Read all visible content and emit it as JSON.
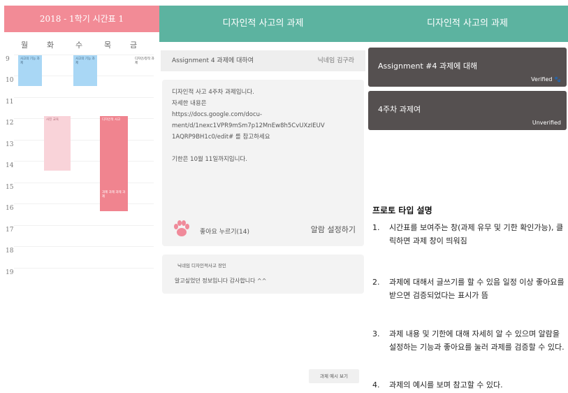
{
  "timetable": {
    "title": "2018 - 1학기 시간표 1",
    "days": [
      "월",
      "화",
      "수",
      "목",
      "금"
    ],
    "hours": [
      "9",
      "10",
      "11",
      "12",
      "13",
      "14",
      "15",
      "16",
      "17",
      "18",
      "19"
    ],
    "blocks": [
      {
        "text": "사고의 기능 과제",
        "color": "blue"
      },
      {
        "text": "사고의 기능 과제",
        "color": "blue"
      },
      {
        "text": "디자인/창작 과제",
        "color": "none"
      },
      {
        "text": "사진 교육",
        "color": "pinkl"
      },
      {
        "text": "디자인적 사고",
        "color": "pinkd"
      },
      {
        "text": "과제 과제 과제 과제",
        "color": "pinkd"
      }
    ]
  },
  "detail": {
    "header": "디자인적 사고의 과제",
    "assignment_title": "Assignment 4 과제에 대하여",
    "nickname": "닉네임 김구라",
    "body_lines": [
      "디자인적 사고 4주차 과제입니다.",
      "자세한 내용은",
      "https://docs.google.com/docu-",
      "ment/d/1nexc1VPR9mSm7p12MnEw8h5CvUXzIEUV",
      "1AQRP9BH1c0/edit# 를 참고하세요"
    ],
    "deadline": "기한은 10월 11일까지입니다.",
    "like_label": "좋아요 누르기(14)",
    "alarm_label": "알람 설정하기",
    "comment_author": "닉네임 디자인적사고 장인",
    "comment_text": "알고싶었던 정보입니다 감사합니다 ^^",
    "example_button": "과제 예시 보기"
  },
  "list": {
    "header": "디자인적 사고의 과제",
    "assignments": [
      {
        "title": "Assignment #4 과제에 대해",
        "status": "Verified 🐾"
      },
      {
        "title": "4주차 과제여",
        "status": "Unverified"
      }
    ]
  },
  "prototype": {
    "title": "프로토 타입 설명",
    "items": [
      {
        "num": "1.",
        "text": "시간표를 보여주는 창(과제 유무 및 기한 확인가능), 클릭하면 과제 창이 띄워짐"
      },
      {
        "num": "2.",
        "text": "과제에 대해서 글쓰기를 할 수 있음 일정 이상 좋아요를 받으면 검증되었다는 표시가 뜸"
      },
      {
        "num": "3.",
        "text": "과제 내용 및 기한에 대해 자세히 알 수 있으며 알람을 설정하는 기능과 좋아요를 눌러 과제를 검증할 수 있다."
      },
      {
        "num": "4.",
        "text": "과제의 예시를 보며 참고할 수 있다."
      }
    ]
  },
  "colors": {
    "accent": "#5cb3a0",
    "timetable_header": "#f28b96",
    "card_dark": "#555050"
  }
}
